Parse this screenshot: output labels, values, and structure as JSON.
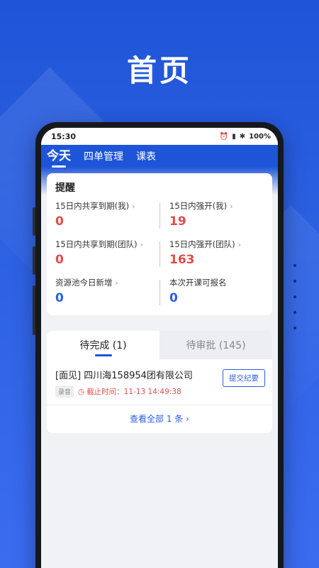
{
  "header": {
    "title": "首页"
  },
  "status_bar": {
    "time": "15:30",
    "battery": "100%"
  },
  "nav": {
    "tabs": [
      {
        "label": "今天",
        "active": true
      },
      {
        "label": "四单管理",
        "active": false
      },
      {
        "label": "课表",
        "active": false
      }
    ]
  },
  "reminder": {
    "title": "提醒",
    "items": [
      {
        "label": "15日内共享到期(我)",
        "value": "0"
      },
      {
        "label": "15日内强开(我)",
        "value": "19"
      },
      {
        "label": "15日内共享到期(团队)",
        "value": "0"
      },
      {
        "label": "15日内强开(团队)",
        "value": "163"
      },
      {
        "label": "资源池今日新增",
        "value": "0"
      },
      {
        "label": "本次开课可报名",
        "value": "0"
      }
    ]
  },
  "tasks": {
    "tabs": [
      {
        "label": "待完成 (1)",
        "active": true
      },
      {
        "label": "待审批 (145)",
        "active": false
      }
    ],
    "items": [
      {
        "title": "[面见] 四川海158954团有限公司",
        "tag": "录音",
        "deadline": "截止时间：11-13 14:49:38",
        "action": "提交纪要"
      }
    ],
    "view_all": "查看全部 1 条"
  },
  "colors": {
    "accent": "#1e55d8",
    "alert": "#e14b4b"
  }
}
